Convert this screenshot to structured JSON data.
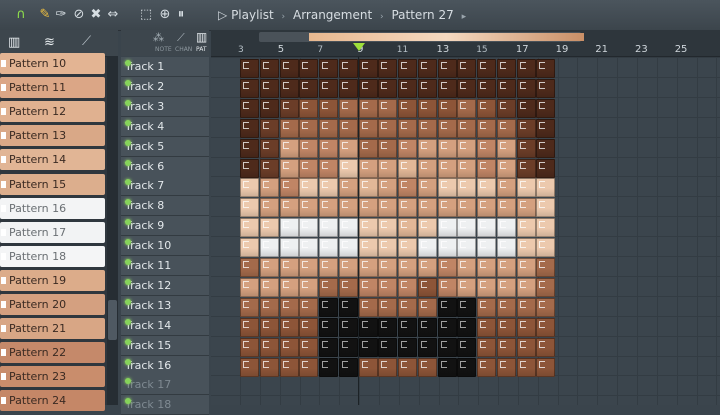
{
  "toolbar": {
    "icons": [
      "magnet-icon",
      "paint-icon",
      "brush-icon",
      "delete-icon",
      "mute-icon",
      "slip-icon",
      "select-icon",
      "zoom-icon",
      "playback-icon",
      "speaker-icon"
    ],
    "breadcrumb": [
      "Playlist",
      "Arrangement",
      "Pattern 27"
    ]
  },
  "picker": {
    "header_icons": [
      "piano-icon",
      "audio-wave-icon",
      "automation-icon"
    ],
    "patterns": [
      {
        "label": "Pattern 10",
        "color": "#e3b493",
        "selected": false
      },
      {
        "label": "Pattern 11",
        "color": "#dba686",
        "selected": false
      },
      {
        "label": "Pattern 12",
        "color": "#e0b190",
        "selected": false
      },
      {
        "label": "Pattern 13",
        "color": "#d9a887",
        "selected": false
      },
      {
        "label": "Pattern 14",
        "color": "#e1b595",
        "selected": false
      },
      {
        "label": "Pattern 15",
        "color": "#dcae8d",
        "selected": false
      },
      {
        "label": "Pattern 16",
        "color": "#f3f4f5",
        "selected": false
      },
      {
        "label": "Pattern 17",
        "color": "#f2f3f4",
        "selected": false
      },
      {
        "label": "Pattern 18",
        "color": "#f4f5f6",
        "selected": false
      },
      {
        "label": "Pattern 19",
        "color": "#dcac8a",
        "selected": false
      },
      {
        "label": "Pattern 20",
        "color": "#d4a080",
        "selected": false
      },
      {
        "label": "Pattern 21",
        "color": "#d8a685",
        "selected": false
      },
      {
        "label": "Pattern 22",
        "color": "#c5896a",
        "selected": false
      },
      {
        "label": "Pattern 23",
        "color": "#c98d6c",
        "selected": false
      },
      {
        "label": "Pattern 24",
        "color": "#c58767",
        "selected": false
      }
    ]
  },
  "header_labels": {
    "note": "NOTE",
    "chan": "CHAN",
    "pat": "PAT"
  },
  "tracks": [
    "Track 1",
    "Track 2",
    "Track 3",
    "Track 4",
    "Track 5",
    "Track 6",
    "Track 7",
    "Track 8",
    "Track 9",
    "Track 10",
    "Track 11",
    "Track 12",
    "Track 13",
    "Track 14",
    "Track 15",
    "Track 16",
    "Track 17",
    "Track 18"
  ],
  "ruler": {
    "major": [
      "3",
      "5",
      "7",
      "9",
      "11",
      "13",
      "15",
      "17",
      "19",
      "21",
      "23",
      "25"
    ]
  },
  "palette": {
    "D": "#4e2a1b",
    "d": "#6b3d28",
    "M": "#8d5538",
    "m": "#a46a4b",
    "L": "#c08565",
    "l": "#d4a07f",
    "P": "#e2b797",
    "p": "#ecc9ad",
    "W": "#eef0f1",
    "K": "#121212"
  },
  "pixel_rows": [
    "DDDDDDDDDDDDDDDD",
    "DDDDDDDDDDDDDDDD",
    "DDdMMmmmMMMmMdDD",
    "DdmmmmmmmmmmmmdD",
    "DdlLLlmmLlllLldD",
    "DdlLLpllPlllLldD",
    "plLpplPlLlppplpp",
    "pllllllllllllllp",
    "ppWWWWppPpWWWWpp",
    "pWWWWWpppWWWWWpp",
    "mlllllllllLllllm",
    "llllmmLLLMLllllm",
    "mmmmKKmmmmKKmmmm",
    "MMMMKKKKKKKKMMMM",
    "MMMMKKKKKKKKMMMM",
    "MMMMKKMMMMKKMMMM"
  ]
}
